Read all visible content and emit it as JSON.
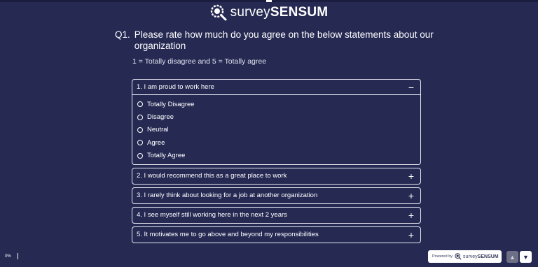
{
  "brand": {
    "name_light": "survey",
    "name_bold": "SENSUM",
    "logo_icon": "magnifier-logo-icon"
  },
  "question": {
    "number": "Q1.",
    "text": "Please rate how much do you agree on the below statements about our organization",
    "scale_hint": "1 = Totally disagree and 5 = Totally agree"
  },
  "statements": [
    {
      "label": "1. I am proud to work here",
      "toggle": "−",
      "expanded": true,
      "options": [
        "Totally Disagree",
        "Disagree",
        "Neutral",
        "Agree",
        "Totally Agree"
      ]
    },
    {
      "label": "2. I would recommend this as a great place to work",
      "toggle": "+",
      "expanded": false
    },
    {
      "label": "3. I rarely think about looking for a job at another organization",
      "toggle": "+",
      "expanded": false
    },
    {
      "label": "4. I see myself still working here in the next 2 years",
      "toggle": "+",
      "expanded": false
    },
    {
      "label": "5. It motivates me to go above and beyond my responsibilities",
      "toggle": "+",
      "expanded": false
    }
  ],
  "footer": {
    "progress_text": "0%",
    "progress": 0,
    "powered_by": "Powered by",
    "powered_name_light": "survey",
    "powered_name_bold": "SENSUM",
    "up_icon": "chevron-up-icon",
    "down_icon": "chevron-down-icon"
  },
  "colors": {
    "background": "#262a53",
    "text": "#ffffff",
    "border": "#e8e9f2"
  }
}
